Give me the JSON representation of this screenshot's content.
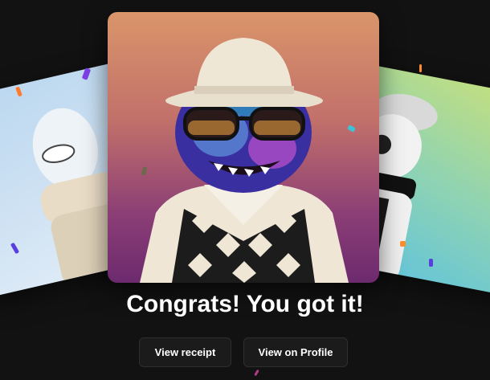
{
  "congrats": {
    "heading": "Congrats! You got it!"
  },
  "actions": {
    "view_receipt_label": "View receipt",
    "view_profile_label": "View on Profile"
  },
  "cards": {
    "left_bg": "#cfe2f3",
    "main_bg_top": "#d9956a",
    "main_bg_bottom": "#6c2a6e",
    "right_bg": "#8fd3b2"
  },
  "colors": {
    "page_bg": "#121212",
    "button_bg": "#1b1b1b",
    "button_border": "#2e2e2e",
    "text": "#ffffff"
  }
}
